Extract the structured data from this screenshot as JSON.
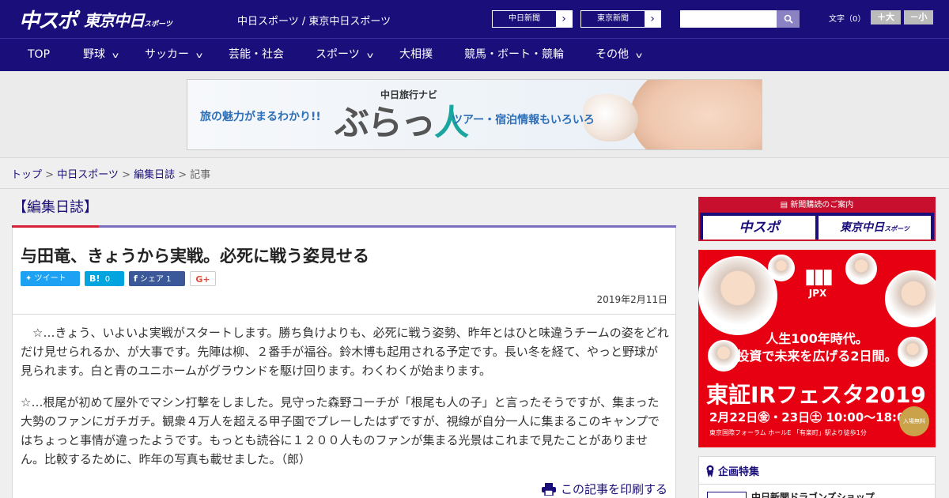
{
  "header": {
    "logo_main": "中スポ",
    "logo_tokyo": "東京中日",
    "logo_tokyo_small": "スポーツ",
    "site_title": "中日スポーツ / 東京中日スポーツ",
    "btn_chunichi": "中日新聞",
    "btn_tokyo": "東京新聞",
    "search_placeholder": "",
    "font_label": "文字（0）",
    "font_up": "＋大",
    "font_down": "－小"
  },
  "nav": {
    "items": [
      {
        "label": "TOP",
        "dropdown": false
      },
      {
        "label": "野球",
        "dropdown": true
      },
      {
        "label": "サッカー",
        "dropdown": true
      },
      {
        "label": "芸能・社会",
        "dropdown": false
      },
      {
        "label": "スポーツ",
        "dropdown": true
      },
      {
        "label": "大相撲",
        "dropdown": false
      },
      {
        "label": "競馬・ボート・競輪",
        "dropdown": false
      },
      {
        "label": "その他",
        "dropdown": true
      }
    ]
  },
  "ad_banner": {
    "left_text": "旅の魅力がまるわかり!!",
    "brand_small": "中日旅行ナビ",
    "brand_big_1": "ぶらっ",
    "brand_big_2": "人",
    "right_text": "ツアー・宿泊情報もいろいろ"
  },
  "breadcrumb": {
    "top": "トップ",
    "sep": " > ",
    "level1": "中日スポーツ",
    "level2": "編集日誌",
    "current": "記事"
  },
  "article": {
    "category": "【編集日誌】",
    "title": "与田竜、きょうから実戦。必死に戦う姿見せる",
    "share": {
      "tweet": "ツイート",
      "hatena_icon": "B!",
      "hatena_count": "0",
      "fb_label": "シェア",
      "fb_count": "1",
      "gplus": "G+"
    },
    "date": "2019年2月11日",
    "paragraphs": [
      "　☆…きょう、いよいよ実戦がスタートします。勝ち負けよりも、必死に戦う姿勢、昨年とはひと味違うチームの姿をどれだけ見せられるか、が大事です。先陣は柳、２番手が福谷。鈴木博も起用される予定です。長い冬を経て、やっと野球が見られます。白と青のユニホームがグラウンドを駆け回ります。わくわくが始まります。",
      "☆…根尾が初めて屋外でマシン打撃をしました。見守った森野コーチが「根尾も人の子」と言ったそうですが、集まった大勢のファンにガチガチ。観衆４万人を超える甲子園でプレーしたはずですが、視線が自分一人に集まるこのキャンプではちょっと事情が違ったようです。もっとも読谷に１２００人ものファンが集まる光景はこれまで見たことがありません。比較するために、昨年の写真も載せました。（郎）"
    ],
    "print_label": "この記事を印刷する"
  },
  "sidebar": {
    "subscribe": {
      "heading": "新聞購読のご案内",
      "btn1": "中スポ",
      "btn2": "東京中日",
      "btn2_small": "スポーツ"
    },
    "jpx_ad": {
      "logo": "JPX",
      "line1": "人生100年時代。",
      "line2": "投資で未来を広げる2日間。",
      "event": "東証IRフェスタ2019",
      "dates": "2月22日㊎・23日㊏ 10:00～18:00",
      "venue": "東京国際フォーラム ホールE 「有楽町」駅より徒歩1分",
      "free": "入場無料"
    },
    "kikaku": {
      "heading": "企画特集",
      "item": "中日新聞ドラゴンズショップ"
    }
  },
  "colors": {
    "brand_navy": "#1a0e7a",
    "accent_red": "#d6213a",
    "twitter": "#1da1f2",
    "hatena": "#00a4de",
    "facebook": "#3b5998"
  }
}
